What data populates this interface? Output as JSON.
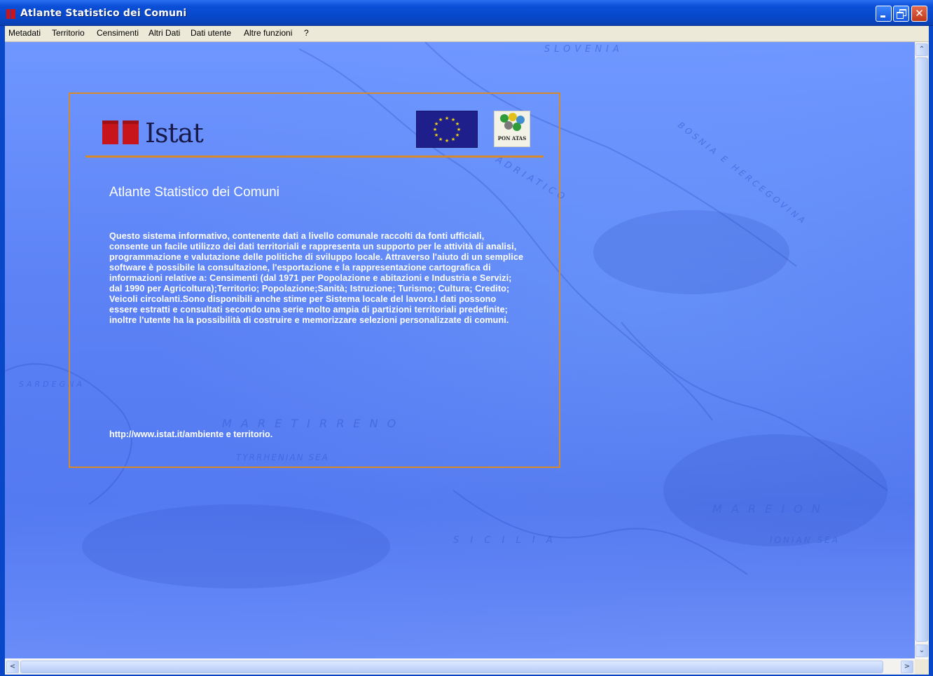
{
  "window": {
    "title": "Atlante Statistico dei Comuni",
    "controls": [
      "minimize-icon",
      "restore-icon",
      "close-icon"
    ],
    "close_glyph": "✕"
  },
  "menu": {
    "items": [
      "Metadati",
      "Territorio",
      "Censimenti",
      "Altri Dati",
      "Dati utente",
      "Altre funzioni",
      "?"
    ]
  },
  "splash": {
    "logo_text": "Istat",
    "pon_logo_text": "PON ATAS",
    "title": "Atlante Statistico dei Comuni",
    "description": "Questo sistema informativo, contenente dati a livello comunale raccolti da fonti ufficiali, consente un facile utilizzo dei dati territoriali e rappresenta un supporto per le attività di analisi, programmazione e valutazione delle politiche di sviluppo locale. Attraverso l'aiuto di un semplice software è possibile la consultazione, l'esportazione e la rappresentazione cartografica di informazioni relative a: Censimenti (dal 1971 per Popolazione e abitazioni e Industria e Servizi; dal 1990 per Agricoltura);Territorio; Popolazione;Sanità; Istruzione; Turismo; Cultura; Credito; Veicoli circolanti.Sono disponibili anche stime per Sistema locale del lavoro.I dati possono essere estratti e consultati secondo una serie molto ampia di partizioni territoriali predefinite; inoltre l'utente ha la possibilità di costruire e memorizzare selezioni personalizzate di comuni.",
    "link": "http://www.istat.it/ambiente e territorio."
  },
  "map_labels": [
    "SLOVENIA",
    "BOSNIA E HERCEGOVINA",
    "SARDEGNA",
    "M A R E   T I R R E N O",
    "TYRRHENIAN SEA",
    "S I C I L I A",
    "M A R E   I O N",
    "IONIAN SEA",
    "ADRIATICO"
  ],
  "scrollbars": {
    "up_arrow": "⌃",
    "down_arrow": "⌄",
    "left_arrow": "<",
    "right_arrow": ">"
  },
  "colors": {
    "titlebar": "#0747c8",
    "panel_border": "#d88a2a",
    "istat_red": "#c8151b",
    "background": "#5c82f5"
  }
}
